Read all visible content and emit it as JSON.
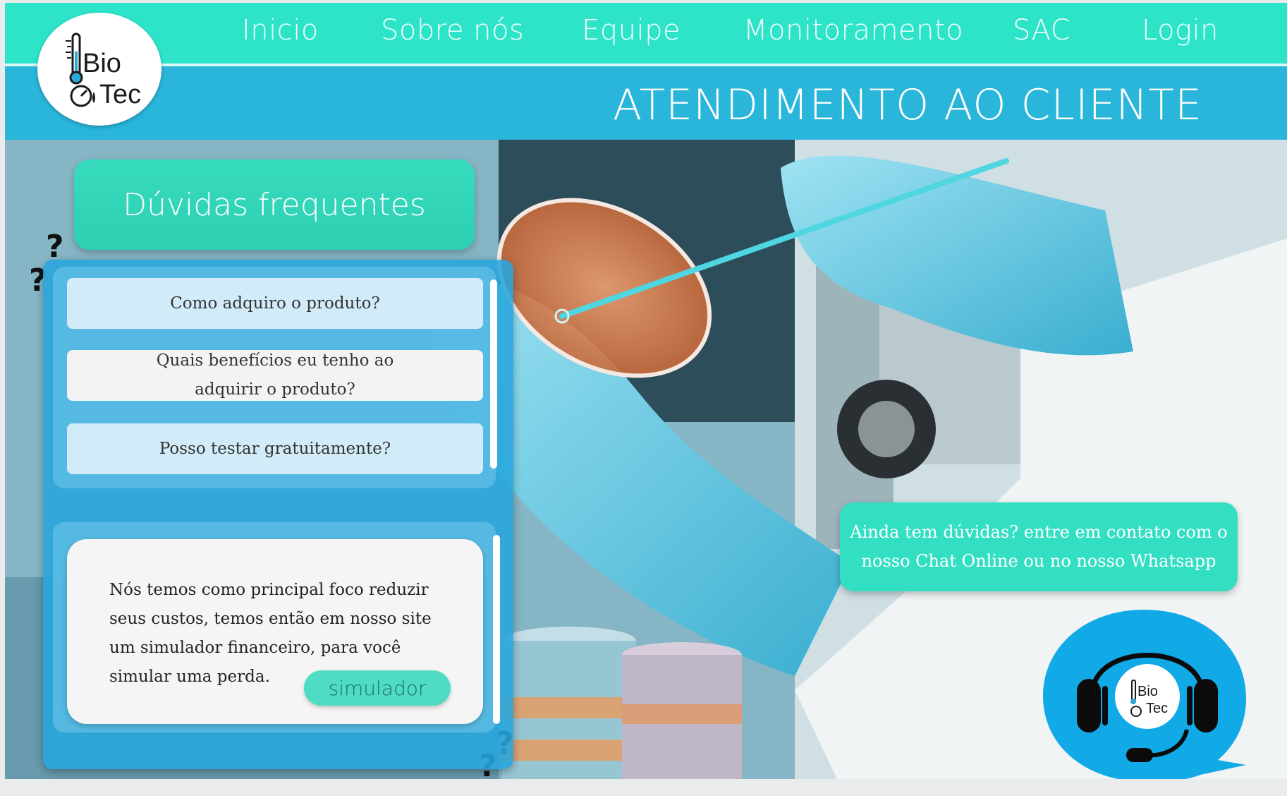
{
  "nav": {
    "items": [
      "Inicio",
      "Sobre nós",
      "Equipe",
      "Monitoramento",
      "SAC",
      "Login"
    ]
  },
  "logo": {
    "line1": "Bio",
    "line2": "Tec"
  },
  "page_title": "ATENDIMENTO AO CLIENTE",
  "faq": {
    "title": "Dúvidas frequentes",
    "questions": [
      "Como adquiro o produto?",
      "Quais benefícios eu tenho ao adquirir o produto?",
      "Posso testar gratuitamente?"
    ],
    "answer": "Nós temos como principal foco reduzir seus custos, temos então em nosso site um simulador financeiro, para você simular uma perda.",
    "button": "simulador"
  },
  "contact": {
    "text": "Ainda tem dúvidas? entre em contato com o nosso Chat Online ou no nosso Whatsapp"
  },
  "chat": {
    "line1": "Bio",
    "line2": "Tec"
  },
  "colors": {
    "nav": "#2de4c9",
    "band": "#2ab5da",
    "faq_panel": "#28a5dc",
    "accent": "#33dfc2",
    "chat": "#11a9e6"
  }
}
